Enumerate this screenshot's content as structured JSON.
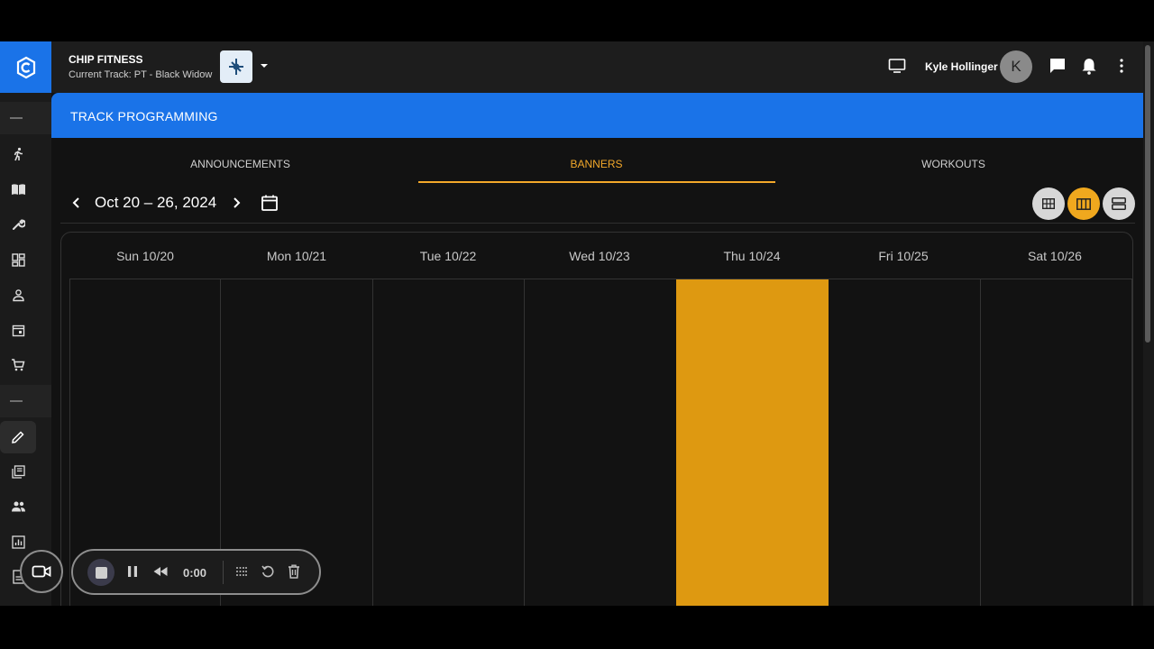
{
  "topbar": {
    "org_name": "CHIP FITNESS",
    "current_track": "Current Track: PT - Black Widow",
    "user_name": "Kyle Hollinger",
    "avatar_initial": "K"
  },
  "page": {
    "title": "TRACK PROGRAMMING"
  },
  "tabs": [
    {
      "label": "ANNOUNCEMENTS",
      "active": false
    },
    {
      "label": "BANNERS",
      "active": true
    },
    {
      "label": "WORKOUTS",
      "active": false
    }
  ],
  "calendar": {
    "range_label": "Oct 20 – 26, 2024",
    "days": [
      "Sun 10/20",
      "Mon 10/21",
      "Tue 10/22",
      "Wed 10/23",
      "Thu 10/24",
      "Fri 10/25",
      "Sat 10/26"
    ],
    "highlighted_day": "Thu 10/24",
    "highlight_color": "#de9911",
    "active_view": "week"
  },
  "recorder": {
    "time": "0:00"
  },
  "colors": {
    "accent": "#1a73e8",
    "active_tab": "#f3a82a"
  }
}
